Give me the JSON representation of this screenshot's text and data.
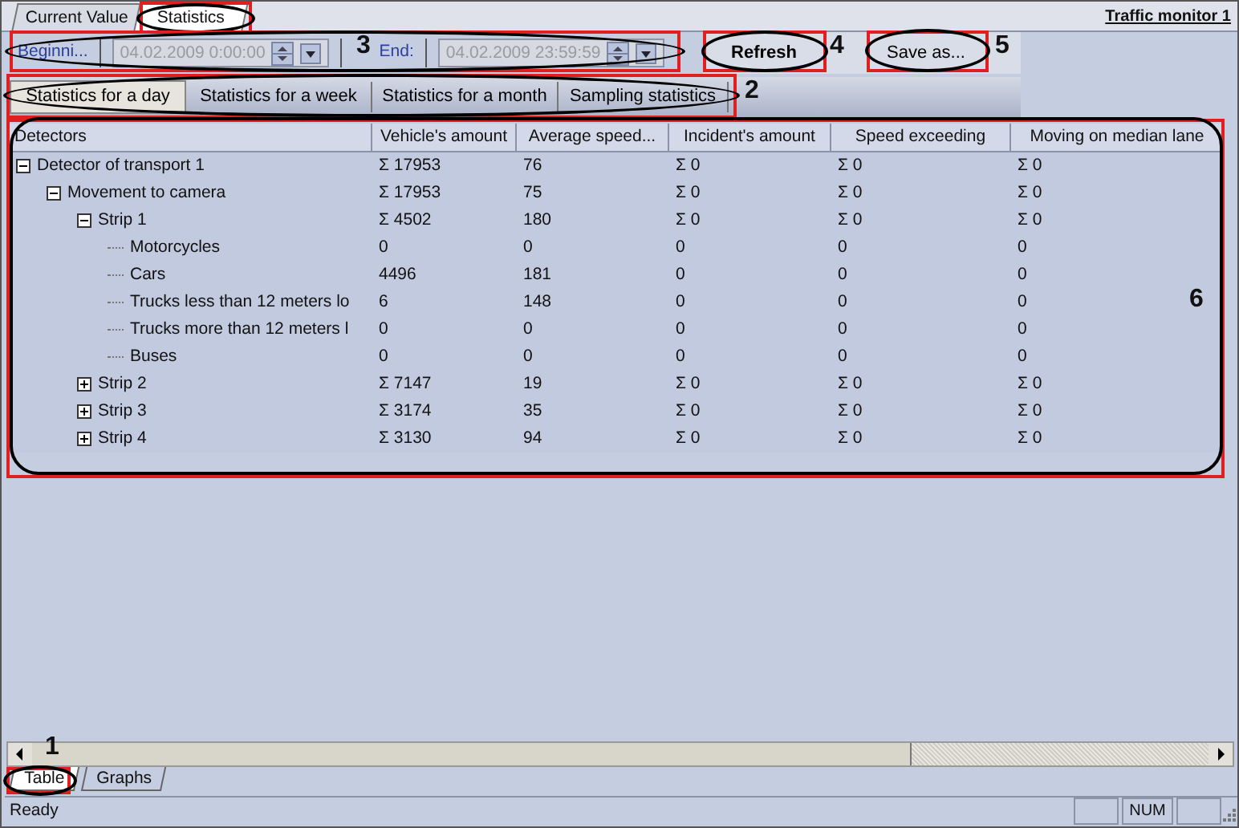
{
  "window_tabs": [
    {
      "label": "Current Value",
      "selected": false
    },
    {
      "label": "Statistics",
      "selected": true
    }
  ],
  "window_title": "Traffic monitor 1",
  "date_range": {
    "begin_label": "Beginni...",
    "begin_value": "04.02.2009 0:00:00",
    "end_label": "End:",
    "end_value": "04.02.2009 23:59:59",
    "disabled": true
  },
  "buttons": [
    {
      "label": "Refresh",
      "default": true
    },
    {
      "label": "Save as...",
      "default": false
    }
  ],
  "period_tabs": [
    {
      "label": "Statistics for a day",
      "selected": true
    },
    {
      "label": "Statistics for a week",
      "selected": false
    },
    {
      "label": "Statistics for a month",
      "selected": false
    },
    {
      "label": "Sampling statistics",
      "selected": false
    }
  ],
  "table": {
    "tree_column": "Detectors",
    "columns": [
      "Vehicle's amount",
      "Average speed...",
      "Incident's amount",
      "Speed exceeding",
      "Moving on median lane"
    ],
    "rows": [
      {
        "label": "Detector of transport 1",
        "expanded": true,
        "cells": [
          "Σ 17953",
          "76",
          "Σ 0",
          "Σ 0",
          "Σ 0"
        ],
        "children": [
          {
            "label": "Movement to camera",
            "expanded": true,
            "cells": [
              "Σ 17953",
              "75",
              "Σ 0",
              "Σ 0",
              "Σ 0"
            ],
            "children": [
              {
                "label": "Strip 1",
                "expanded": true,
                "cells": [
                  "Σ 4502",
                  "180",
                  "Σ 0",
                  "Σ 0",
                  "Σ 0"
                ],
                "children": [
                  {
                    "label": "Motorcycles",
                    "cells": [
                      "0",
                      "0",
                      "0",
                      "0",
                      "0"
                    ]
                  },
                  {
                    "label": "Cars",
                    "cells": [
                      "4496",
                      "181",
                      "0",
                      "0",
                      "0"
                    ]
                  },
                  {
                    "label": "Trucks less than 12 meters lo",
                    "cells": [
                      "6",
                      "148",
                      "0",
                      "0",
                      "0"
                    ]
                  },
                  {
                    "label": "Trucks more than 12 meters l",
                    "cells": [
                      "0",
                      "0",
                      "0",
                      "0",
                      "0"
                    ]
                  },
                  {
                    "label": "Buses",
                    "cells": [
                      "0",
                      "0",
                      "0",
                      "0",
                      "0"
                    ]
                  }
                ]
              },
              {
                "label": "Strip 2",
                "expanded": false,
                "cells": [
                  "Σ 7147",
                  "19",
                  "Σ 0",
                  "Σ 0",
                  "Σ 0"
                ]
              },
              {
                "label": "Strip 3",
                "expanded": false,
                "cells": [
                  "Σ 3174",
                  "35",
                  "Σ 0",
                  "Σ 0",
                  "Σ 0"
                ]
              },
              {
                "label": "Strip 4",
                "expanded": false,
                "cells": [
                  "Σ 3130",
                  "94",
                  "Σ 0",
                  "Σ 0",
                  "Σ 0"
                ]
              }
            ]
          }
        ]
      }
    ]
  },
  "view_tabs": [
    {
      "label": "Table",
      "selected": true
    },
    {
      "label": "Graphs",
      "selected": false
    }
  ],
  "status_bar": {
    "text": "Ready",
    "indicators": [
      "NUM"
    ]
  },
  "callouts": [
    {
      "kind": "ellipse"
    },
    {
      "kind": "ellipse",
      "label": "3"
    },
    {
      "kind": "ellipse",
      "label": "4"
    },
    {
      "kind": "ellipse",
      "label": "5"
    },
    {
      "kind": "ellipse",
      "label": "2"
    },
    {
      "kind": "rounded",
      "label": "6"
    },
    {
      "kind": "ellipse",
      "label": "1"
    }
  ]
}
